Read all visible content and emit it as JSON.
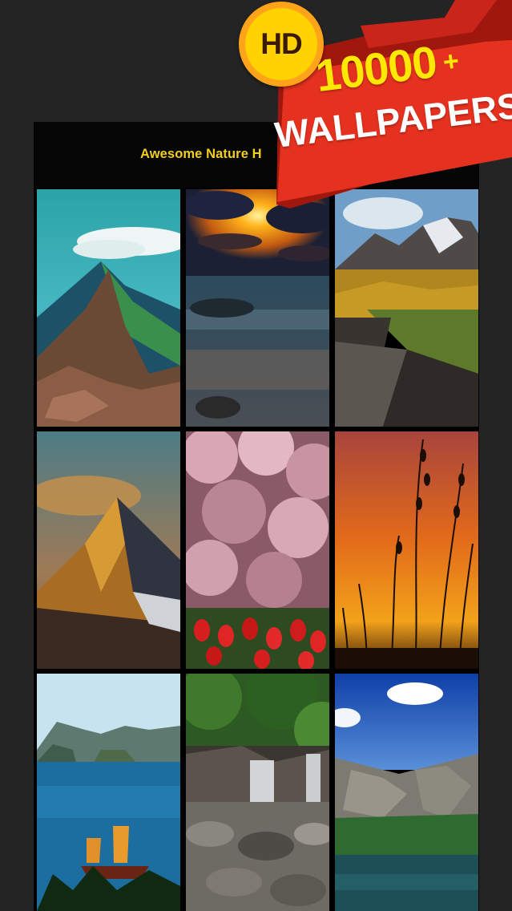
{
  "nav": {
    "title": "Awesome Nature H"
  },
  "promo": {
    "hd_label": "HD",
    "count": "10000",
    "plus": "+",
    "wallpapers_label": "WALLPAPERS"
  },
  "wallpapers": [
    {
      "id": "mountain-ridge"
    },
    {
      "id": "ocean-sunset"
    },
    {
      "id": "snowy-peaks-stream"
    },
    {
      "id": "golden-peak"
    },
    {
      "id": "cherry-blossom-tulips"
    },
    {
      "id": "orange-sunset-grass"
    },
    {
      "id": "ha-long-bay-junk"
    },
    {
      "id": "waterfall-rocks"
    },
    {
      "id": "alpine-lake"
    }
  ],
  "colors": {
    "title": "#f2cf1f",
    "ribbon": "#e5311f",
    "hd_badge": "#ffd200",
    "count_text": "#ffe800"
  }
}
